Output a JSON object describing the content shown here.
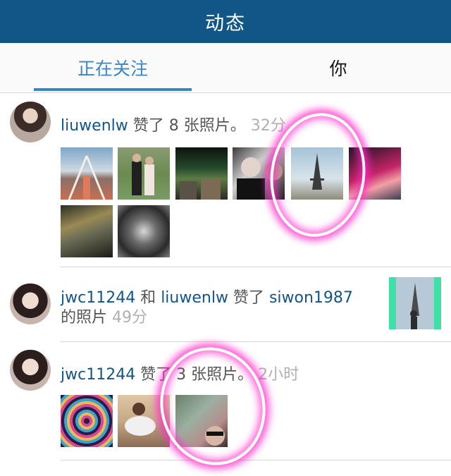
{
  "header": {
    "title": "动态"
  },
  "tabs": [
    {
      "label": "正在关注",
      "active": true
    },
    {
      "label": "你",
      "active": false
    }
  ],
  "feed": [
    {
      "user": "liuwenlw",
      "action": " 赞了 8 张照片。",
      "time": "32分",
      "photos": [
        "boat-photo",
        "couple-photo",
        "aurora-photo",
        "man-photo",
        "eiffel-photo",
        "sunset-photo",
        "beach-photo",
        "artwork-photo"
      ]
    },
    {
      "user1": "jwc11244",
      "and": " 和 ",
      "user2": "liuwenlw",
      "liked": " 赞了 ",
      "target": "siwon1987",
      "suffix": "的照片",
      "time": "49分",
      "thumbnail": "eiffel-person-photo"
    },
    {
      "user": "jwc11244",
      "action": " 赞了 3 张照片。",
      "time": "2小时",
      "photos": [
        "tunnel-photo",
        "girl-photo",
        "selfie-photo"
      ]
    }
  ],
  "colors": {
    "header": "#125688",
    "accent": "#3a87c8",
    "username": "#125688",
    "highlight": "#ff28c8"
  }
}
